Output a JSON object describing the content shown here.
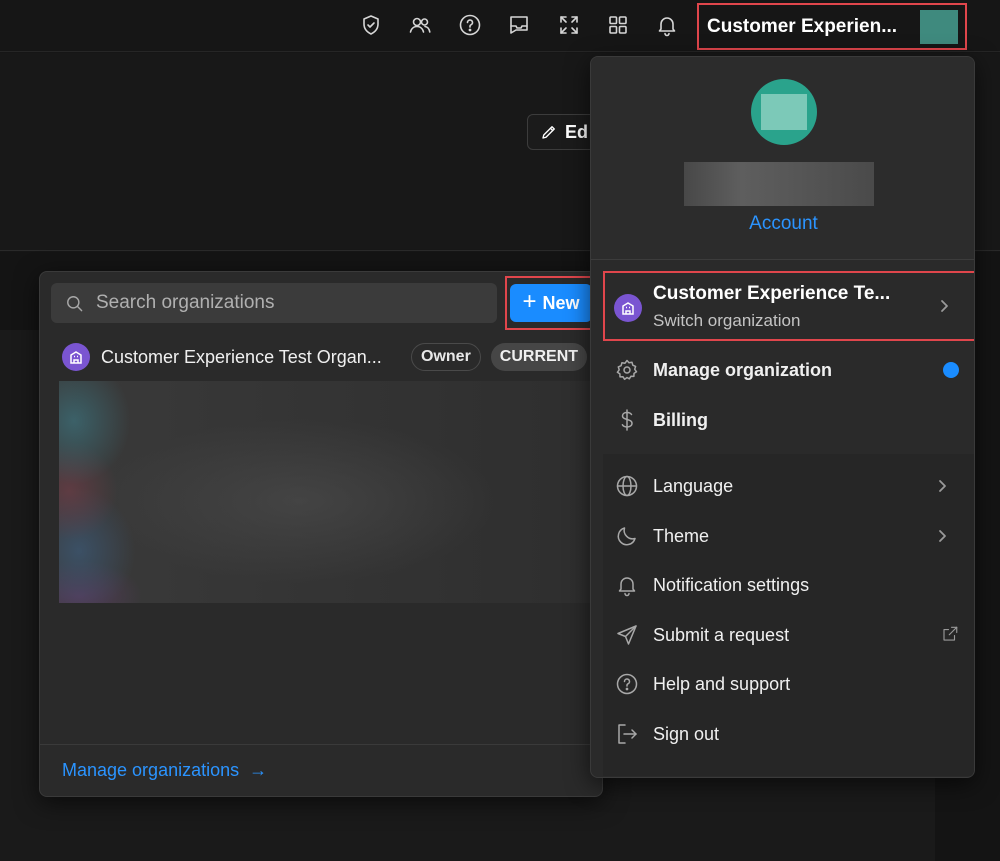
{
  "topbar": {
    "icons": [
      "shield-check-icon",
      "people-icon",
      "help-icon",
      "inbox-icon",
      "expand-icon",
      "apps-grid-icon",
      "bell-icon"
    ],
    "account_name": "Customer Experien...",
    "avatar_color": "#3f8a7e"
  },
  "background": {
    "edit_label": "Ed"
  },
  "org_switcher": {
    "search_placeholder": "Search organizations",
    "search_value": "",
    "new_button_label": "New",
    "orgs": [
      {
        "name": "Customer Experience Test Organ...",
        "role_badge": "Owner",
        "status_badge": "CURRENT"
      }
    ],
    "manage_link_label": "Manage organizations",
    "accent_color": "#2b94ff"
  },
  "account_menu": {
    "account_link_label": "Account",
    "current_org": {
      "name": "Customer Experience Te...",
      "subtitle": "Switch organization"
    },
    "org_items": [
      {
        "label": "Manage organization",
        "icon": "gear-icon",
        "has_dot": true
      },
      {
        "label": "Billing",
        "icon": "dollar-icon"
      }
    ],
    "items": [
      {
        "label": "Language",
        "icon": "globe-icon",
        "has_chevron": true
      },
      {
        "label": "Theme",
        "icon": "moon-icon",
        "has_chevron": true
      },
      {
        "label": "Notification settings",
        "icon": "bell-icon"
      },
      {
        "label": "Submit a request",
        "icon": "send-icon",
        "external": true
      },
      {
        "label": "Help and support",
        "icon": "help-icon"
      },
      {
        "label": "Sign out",
        "icon": "sign-out-icon"
      }
    ],
    "highlight_color": "#e0464c",
    "dot_color": "#1a8cff"
  }
}
